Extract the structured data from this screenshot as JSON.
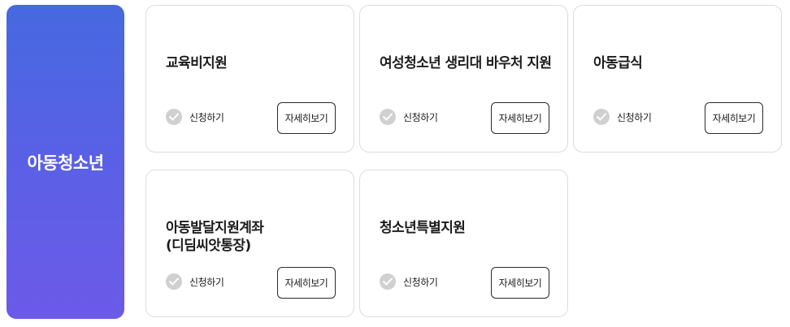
{
  "category": {
    "title": "아동청소년"
  },
  "cards": [
    {
      "title": "교육비지원",
      "apply_label": "신청하기",
      "detail_label": "자세히보기"
    },
    {
      "title": "여성청소년 생리대 바우처 지원",
      "apply_label": "신청하기",
      "detail_label": "자세히보기"
    },
    {
      "title": "아동급식",
      "apply_label": "신청하기",
      "detail_label": "자세히보기"
    },
    {
      "title": "아동발달지원계좌(디딤씨앗통장)",
      "apply_label": "신청하기",
      "detail_label": "자세히보기"
    },
    {
      "title": "청소년특별지원",
      "apply_label": "신청하기",
      "detail_label": "자세히보기"
    }
  ],
  "colors": {
    "panel_gradient_top": "#4669e0",
    "panel_gradient_bottom": "#6c5ae9",
    "check_icon": "#d0d0d0"
  }
}
